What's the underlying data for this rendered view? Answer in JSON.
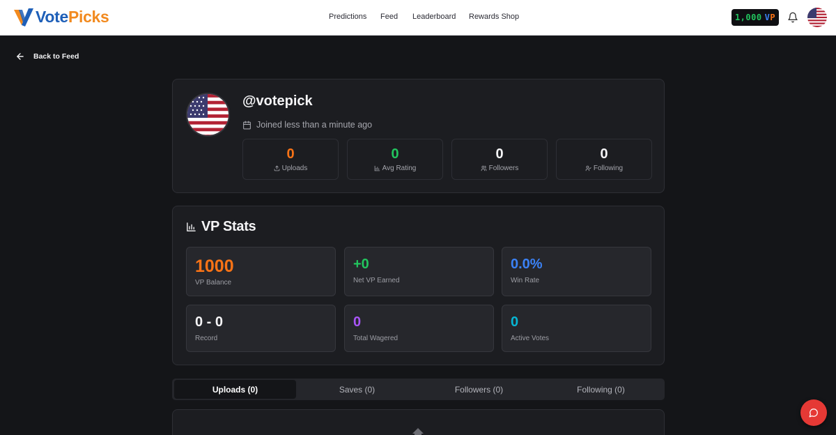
{
  "brand": {
    "name_part1": "Vote",
    "name_part2": "Picks"
  },
  "nav": {
    "items": [
      "Predictions",
      "Feed",
      "Leaderboard",
      "Rewards Shop"
    ]
  },
  "header": {
    "vp_balance": "1,000",
    "vp_unit_v": "V",
    "vp_unit_p": "P"
  },
  "back_label": "Back to Feed",
  "profile": {
    "username": "@votepick",
    "joined": "Joined less than a minute ago",
    "stats": [
      {
        "value": "0",
        "label": "Uploads",
        "icon": "upload-icon",
        "color": "#f97316"
      },
      {
        "value": "0",
        "label": "Avg Rating",
        "icon": "bar-chart-icon",
        "color": "#22c55e"
      },
      {
        "value": "0",
        "label": "Followers",
        "icon": "users-icon",
        "color": "#f5f5f7"
      },
      {
        "value": "0",
        "label": "Following",
        "icon": "user-check-icon",
        "color": "#f5f5f7"
      }
    ]
  },
  "vp_stats": {
    "title": "VP Stats",
    "tiles": [
      {
        "value": "1000",
        "label": "VP Balance",
        "color": "#f97316"
      },
      {
        "value": "+0",
        "label": "Net VP Earned",
        "color": "#22c55e"
      },
      {
        "value": "0.0%",
        "label": "Win Rate",
        "color": "#3b82f6"
      },
      {
        "value": "0 - 0",
        "label": "Record",
        "color": "#f5f5f7"
      },
      {
        "value": "0",
        "label": "Total Wagered",
        "color": "#a855f7"
      },
      {
        "value": "0",
        "label": "Active Votes",
        "color": "#06b6d4"
      }
    ]
  },
  "tabs": [
    "Uploads (0)",
    "Saves (0)",
    "Followers (0)",
    "Following (0)"
  ],
  "active_tab": "Uploads (0)"
}
